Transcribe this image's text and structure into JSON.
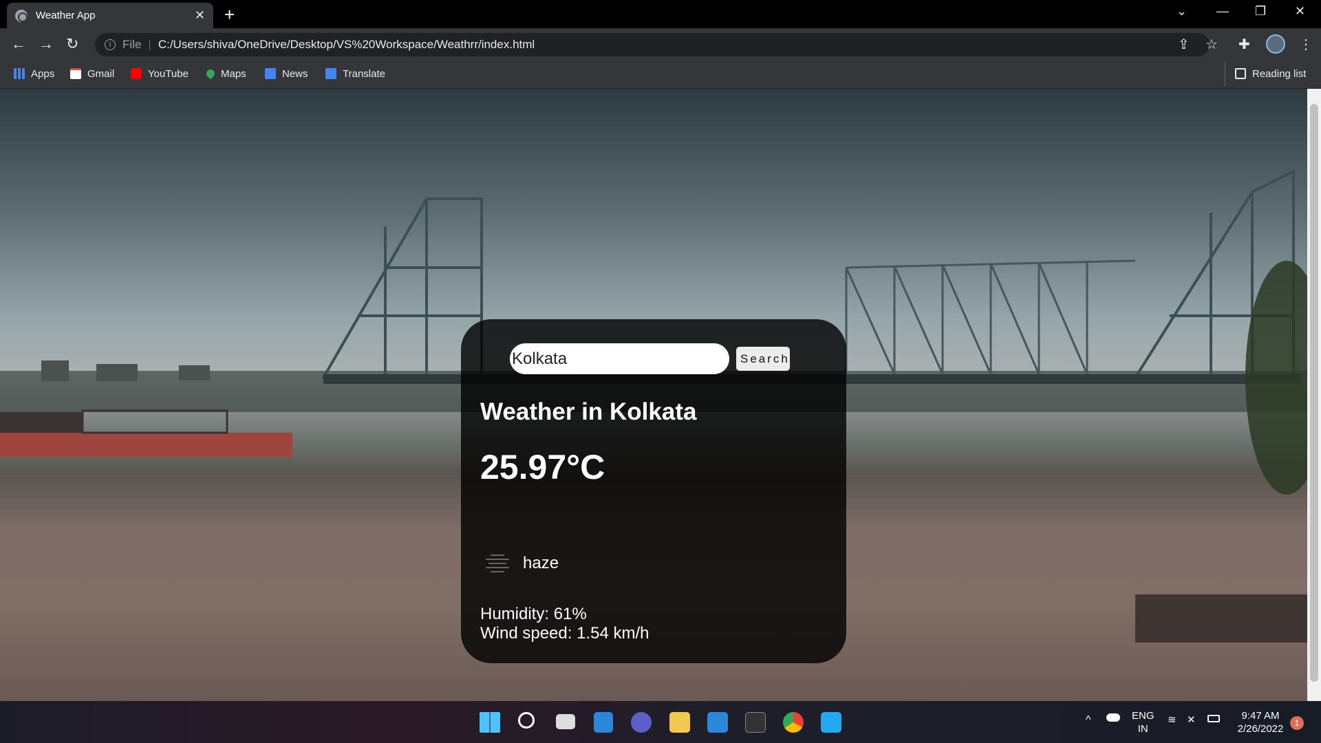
{
  "browser": {
    "tab_title": "Weather App",
    "address_file": "File",
    "address_url": "C:/Users/shiva/OneDrive/Desktop/VS%20Workspace/Weathrr/index.html",
    "bookmarks": [
      {
        "label": "Apps",
        "icon": "apps-grid-icon",
        "color": "#4285f4"
      },
      {
        "label": "Gmail",
        "icon": "gmail-icon",
        "color": "#ea4335"
      },
      {
        "label": "YouTube",
        "icon": "youtube-icon",
        "color": "#ff0000"
      },
      {
        "label": "Maps",
        "icon": "maps-pin-icon",
        "color": "#34a853"
      },
      {
        "label": "News",
        "icon": "news-icon",
        "color": "#4285f4"
      },
      {
        "label": "Translate",
        "icon": "translate-icon",
        "color": "#4285f4"
      }
    ],
    "reading_list": "Reading list"
  },
  "weather": {
    "search_value": "Kolkata",
    "search_button": "Search",
    "city_heading": "Weather in Kolkata",
    "temperature": "25.97°C",
    "description": "haze",
    "humidity": "Humidity: 61%",
    "wind": "Wind speed: 1.54 km/h"
  },
  "taskbar": {
    "lang_line1": "ENG",
    "lang_line2": "IN",
    "time": "9:47 AM",
    "date": "2/26/2022",
    "notification_count": "1"
  }
}
